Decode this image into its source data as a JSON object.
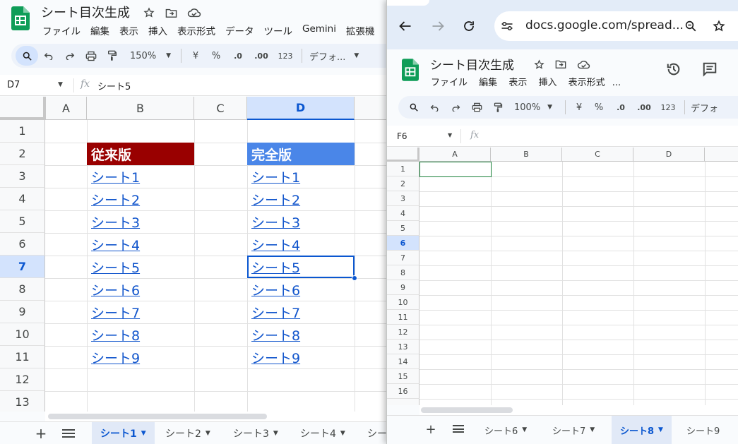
{
  "main": {
    "title": "シート目次生成",
    "menu": [
      "ファイル",
      "編集",
      "表示",
      "挿入",
      "表示形式",
      "データ",
      "ツール",
      "Gemini",
      "拡張機"
    ],
    "toolbar": {
      "zoom": "150%",
      "currency": "¥",
      "percent": "%",
      "dec_decrease": ".0",
      "dec_increase": ".00",
      "number_format": "123",
      "font": "デフォ..."
    },
    "name_box": "D7",
    "formula": "シート5",
    "columns": [
      "A",
      "B",
      "C",
      "D"
    ],
    "selected_column": "D",
    "rows": [
      "1",
      "2",
      "3",
      "4",
      "5",
      "6",
      "7",
      "8",
      "9",
      "10",
      "11",
      "12",
      "13"
    ],
    "selected_row": "7",
    "header_b": "従来版",
    "header_d": "完全版",
    "links_b": [
      "シート1",
      "シート2",
      "シート3",
      "シート4",
      "シート5",
      "シート6",
      "シート7",
      "シート8",
      "シート9"
    ],
    "links_d": [
      "シート1",
      "シート2",
      "シート3",
      "シート4",
      "シート5",
      "シート6",
      "シート7",
      "シート8",
      "シート9"
    ],
    "tabs": [
      "シート1",
      "シート2",
      "シート3",
      "シート4",
      "シー"
    ],
    "active_tab": "シート1",
    "colors": {
      "header_b_bg": "#990000",
      "header_d_bg": "#4a86e8",
      "link": "#1155cc",
      "selection": "#0b57d0",
      "tab_active_bg": "#e1e9f7"
    }
  },
  "browser": {
    "url": "docs.google.com/spread..."
  },
  "right": {
    "title": "シート目次生成",
    "menu": [
      "ファイル",
      "編集",
      "表示",
      "挿入",
      "表示形式",
      "..."
    ],
    "toolbar": {
      "zoom": "100%",
      "currency": "¥",
      "percent": "%",
      "dec_decrease": ".0",
      "dec_increase": ".00",
      "number_format": "123",
      "font": "デフォ"
    },
    "name_box": "F6",
    "columns": [
      "A",
      "B",
      "C",
      "D"
    ],
    "rows": [
      "1",
      "2",
      "3",
      "4",
      "5",
      "6",
      "7",
      "8",
      "9",
      "10",
      "11",
      "12",
      "13",
      "14",
      "15",
      "16"
    ],
    "selected_row": "6",
    "tabs": [
      "シート6",
      "シート7",
      "シート8",
      "シート9"
    ],
    "active_tab": "シート8"
  }
}
